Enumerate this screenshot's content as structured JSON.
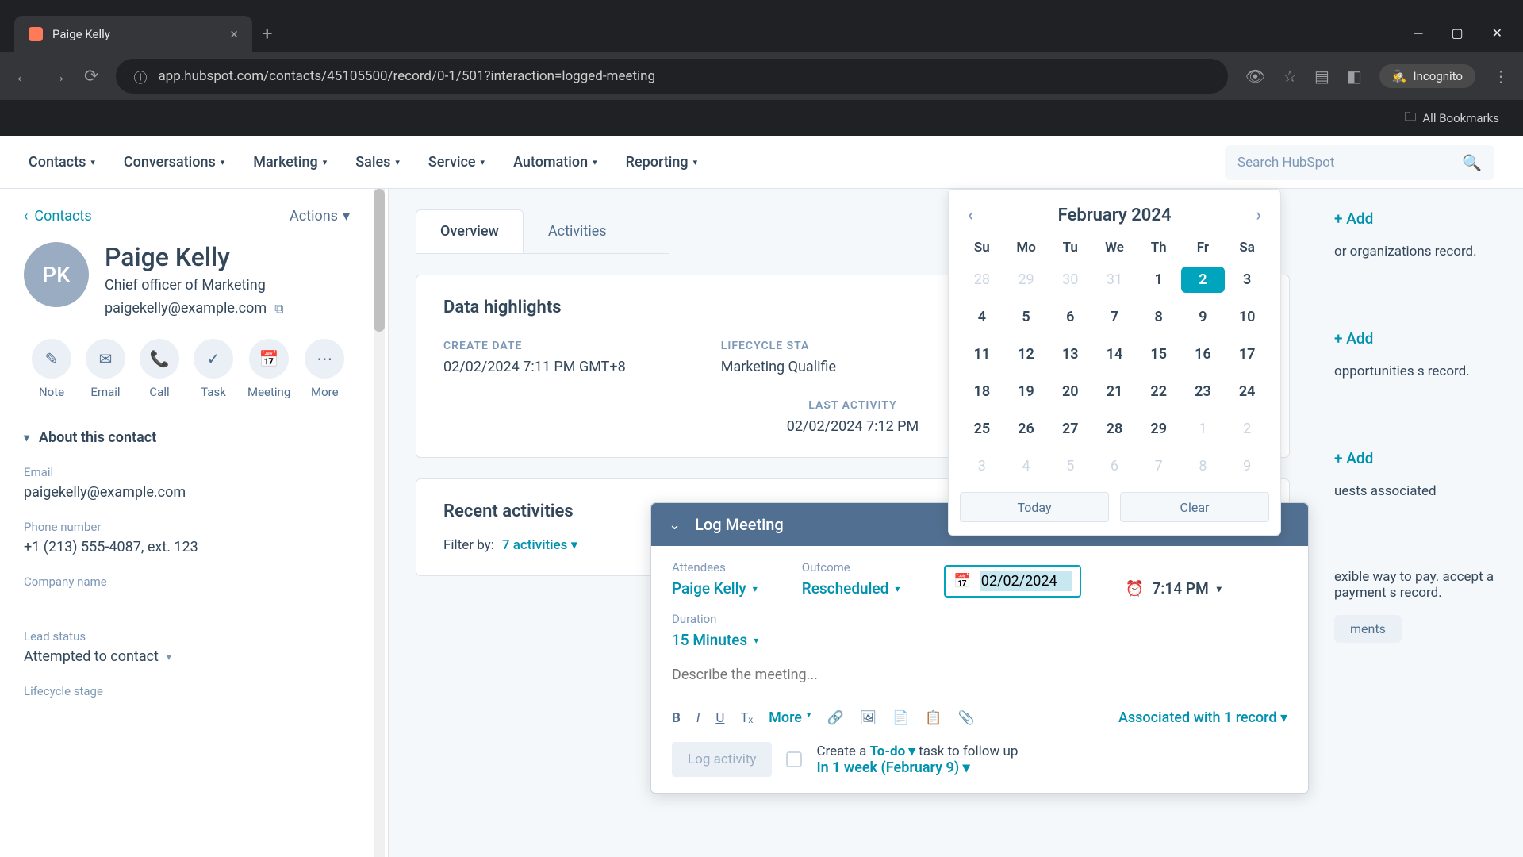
{
  "browser": {
    "tab_title": "Paige Kelly",
    "url": "app.hubspot.com/contacts/45105500/record/0-1/501?interaction=logged-meeting",
    "incognito": "Incognito",
    "bookmarks": "All Bookmarks"
  },
  "nav": {
    "items": [
      "Contacts",
      "Conversations",
      "Marketing",
      "Sales",
      "Service",
      "Automation",
      "Reporting"
    ],
    "search_placeholder": "Search HubSpot"
  },
  "sidebar": {
    "back": "Contacts",
    "actions": "Actions",
    "initials": "PK",
    "name": "Paige Kelly",
    "title": "Chief officer of Marketing",
    "email": "paigekelly@example.com",
    "quick": [
      "Note",
      "Email",
      "Call",
      "Task",
      "Meeting",
      "More"
    ],
    "about_h": "About this contact",
    "fields": {
      "email_l": "Email",
      "email_v": "paigekelly@example.com",
      "phone_l": "Phone number",
      "phone_v": "+1 (213) 555-4087, ext. 123",
      "company_l": "Company name",
      "lead_l": "Lead status",
      "lead_v": "Attempted to contact",
      "life_l": "Lifecycle stage"
    }
  },
  "center": {
    "tabs": [
      "Overview",
      "Activities"
    ],
    "dh_h": "Data highlights",
    "create_l": "CREATE DATE",
    "create_v": "02/02/2024 7:11 PM GMT+8",
    "life_l": "LIFECYCLE STA",
    "life_v": "Marketing Qualifie",
    "last_l": "LAST ACTIVITY",
    "last_v": "02/02/2024 7:12 PM",
    "ra_h": "Recent activities",
    "filter_l": "Filter by:",
    "filter_v": "7 activities",
    "add": "Add"
  },
  "right": {
    "add": "+ Add",
    "t1": "or organizations record.",
    "t2": "opportunities s record.",
    "t3": "uests associated",
    "t4": "exible way to pay. accept a payment s record.",
    "pill": "ments"
  },
  "calendar": {
    "title": "February 2024",
    "days": [
      "Su",
      "Mo",
      "Tu",
      "We",
      "Th",
      "Fr",
      "Sa"
    ],
    "today": "Today",
    "clear": "Clear",
    "selected": 2
  },
  "logmeet": {
    "title": "Log Meeting",
    "att_l": "Attendees",
    "att_v": "Paige Kelly",
    "out_l": "Outcome",
    "out_v": "Rescheduled",
    "date_v": "02/02/2024",
    "time_v": "7:14 PM",
    "dur_l": "Duration",
    "dur_v": "15 Minutes",
    "desc_ph": "Describe the meeting...",
    "more": "More",
    "assoc": "Associated with 1 record",
    "log_btn": "Log activity",
    "todo1": "Create a ",
    "todo_b": "To-do",
    "todo2": " task to follow up",
    "week": "In 1 week (February 9)"
  }
}
